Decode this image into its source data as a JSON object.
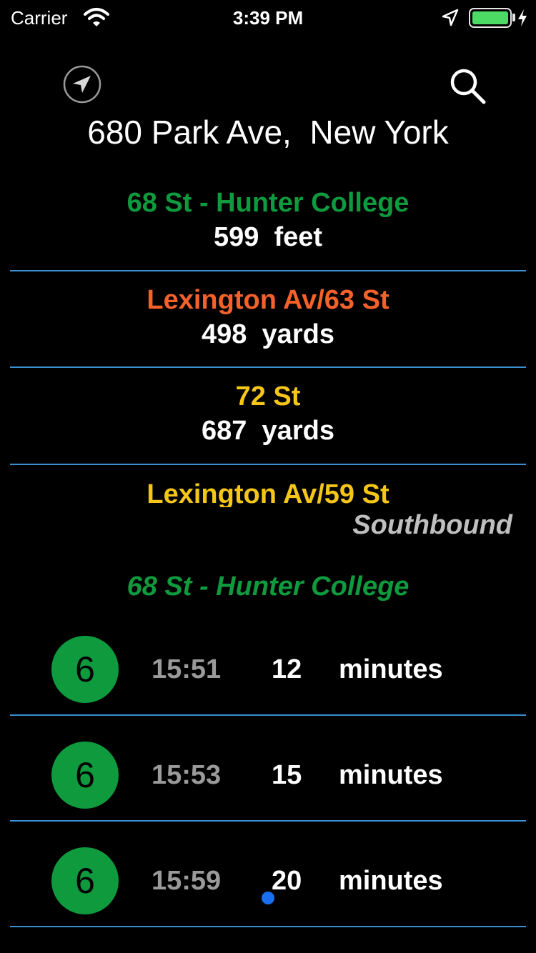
{
  "status_bar": {
    "carrier": "Carrier",
    "time": "3:39 PM",
    "battery_color": "#4cd964"
  },
  "header": {
    "locate_icon": "location-arrow-icon",
    "search_icon": "search-icon",
    "address": "680 Park Ave,  New York"
  },
  "stations": [
    {
      "name": "68 St - Hunter College",
      "distance": "599  feet",
      "color": "#0f9a3e"
    },
    {
      "name": "Lexington Av/63 St",
      "distance": "498  yards",
      "color": "#f4622a"
    },
    {
      "name": "72 St",
      "distance": "687  yards",
      "color": "#f5c518"
    },
    {
      "name": "Lexington Av/59 St",
      "color": "#f5c518"
    }
  ],
  "arrivals": {
    "direction": "Southbound",
    "station": "68 St - Hunter College",
    "station_color": "#0f9a3e",
    "route_color": "#0f9a3e",
    "rows": [
      {
        "route": "6",
        "time": "15:51",
        "minutes": "12",
        "unit": "minutes"
      },
      {
        "route": "6",
        "time": "15:53",
        "minutes": "15",
        "unit": "minutes"
      },
      {
        "route": "6",
        "time": "15:59",
        "minutes": "20",
        "unit": "minutes"
      }
    ]
  }
}
